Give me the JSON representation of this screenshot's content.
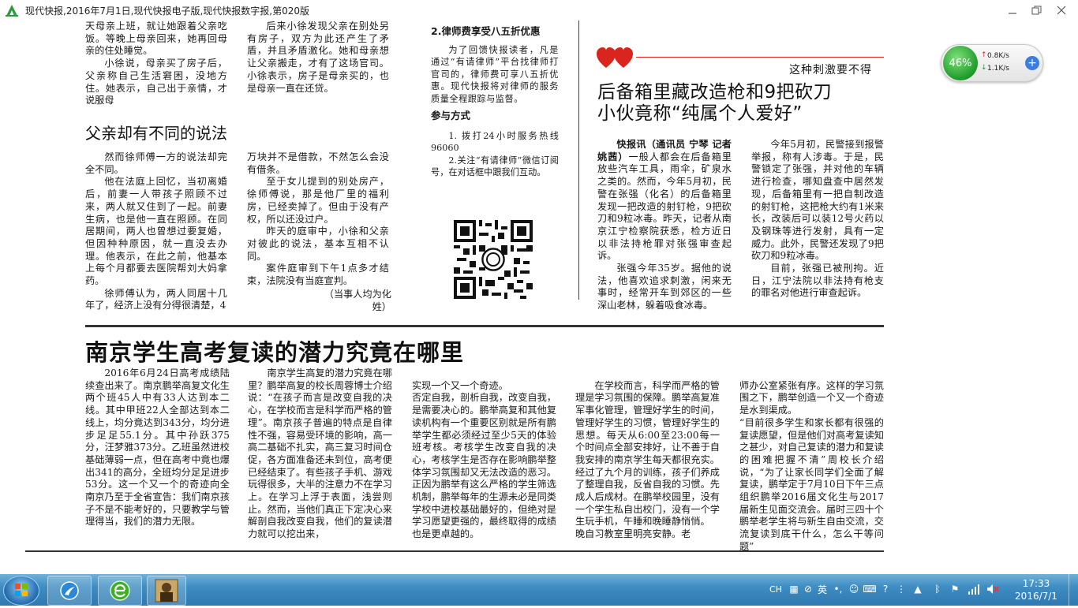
{
  "window": {
    "title": "现代快报,2016年7月1日,现代快报电子版,现代快报数字报,第020版"
  },
  "article_top_left": {
    "col1_lines": [
      "天母亲上班，就让她跟着父亲吃饭。等晚上母亲回来，她再回母亲的住处睡觉。",
      "小徐说，母亲买了房子后，父亲称自己生活窘困，没地方住。她表示，自己出于亲情，才说服母"
    ],
    "col2_lines": [
      "后来小徐发现父亲在别处另有房子，双方为此还产生了矛盾，并且矛盾激化。她和母亲想让父亲搬走，才有了这场官司。小徐表示，房子是母亲买的，也是母亲一直在还贷。"
    ],
    "subheading": "父亲却有不同的说法",
    "col1_body": [
      "然而徐师傅一方的说法却完全不同。",
      "他在法庭上回忆，当初离婚后，前妻一人带孩子照顾不过来，两人就又住到了一起。前妻生病，也是他一直在照顾。在同居期间，两人也曾想过要复婚，但因种种原因，就一直没去办理。他表示，在此之前，他基本上每个月都要去医院帮刘大妈拿药。",
      "徐师傅认为，两人同居十几年了，经济上没有分得很清楚，4"
    ],
    "col2_body": [
      "万块并不是借款，不然怎么会没有借条。",
      "至于女儿提到的别处房产，徐师傅说，那是他厂里的福利房，已经卖掉了。但由于没有产权，所以还没过户。",
      "昨天的庭审中，小徐和父亲对彼此的说法，基本互相不认同。",
      "案件庭审到下午1点多才结束，法院没有当庭宣判。"
    ],
    "note": "（当事人均为化姓）"
  },
  "sidebar": {
    "item2_title": "2.律师费享受八五折优惠",
    "item2_text": "为了回馈快报读者，凡是通过“有请律师”平台找律师打官司的，律师费可享八五折优惠。现代快报将对律师的服务质量全程跟踪与监督。",
    "how_title": "参与方式",
    "how_1": "1. 拨打24小时服务热线96060",
    "how_2": "2.关注“有请律师”微信订阅号，在对话框中跟我们互动。"
  },
  "article_gun": {
    "kicker": "这种刺激要不得",
    "headline_1": "后备箱里藏改造枪和9把砍刀",
    "headline_2": "小伙竟称“纯属个人爱好”",
    "byline": "快报讯（通讯员 宁琴 记者 姚茜）",
    "col1": [
      "一般人都会在后备箱里放些汽车工具，雨伞，矿泉水之类的。然而，今年5月初，民警在张强（化名）的后备箱里发现一把改造的射钉枪，9把砍刀和9粒冰毒。昨天，记者从南京江宁检察院获悉，检方近日以非法持枪罪对张强审查起诉。",
      "张强今年35岁。据他的说法，他喜欢追求刺激，闲来无事时，经常开车到郊区的一些深山老林，躲着吸食冰毒。"
    ],
    "col2": [
      "今年5月初，民警接到报警举报，称有人涉毒。于是，民警锁定了张强，并对他的车辆进行检查，哪知盘查中居然发现，后备箱里有一把自制改造的射钉枪，这把枪大约有1米来长，改装后可以装12号火药以及钢珠等进行发射，具有一定威力。此外，民警还发现了9把砍刀和9粒冰毒。",
      "目前，张强已被刑拘。近日，江宁法院以非法持有枪支的罪名对他进行审查起诉。"
    ]
  },
  "article_exam": {
    "headline": "南京学生高考复读的潜力究竟在哪里",
    "col1": "2016年6月24日高考成绩陆续查出来了。南京鹏举高复文化生两个班45人中有33人达到本二线。其中甲班22人全部达到本二线上，均分竟达到343分，均分进步足足55.1分。其中孙跃375分，汪梦雅373分。乙班虽然进校基础薄弱一点，但在高考中竟也爆出341的高分，全班均分足足进步53分。这一个又一个的奇迹向全南京乃至于全省宣告：我们南京孩子不是不能考好的，只要教学与管理得当，我们的潜力无限。",
    "col2": "南京学生高复的潜力究竟在哪里？鹏举高复的校长周蓉博士介绍说：“在孩子而言是改变自我的决心，在学校而言是科学而严格的管理”。南京孩子普遍的特点是自律性不强，容易受环境的影响，高一高二基础不扎实，高三复习时间仓促，各方面准备还未到位，高考便已经结束了。有些孩子手机、游戏玩得很多，大半的注意力不在学习上。在学习上浮于表面，浅尝则止。然而，当他们真正下定决心来解剖自我改变自我，他们的复读潜力就可以挖出来，",
    "col3": "实现一个又一个奇迹。\n否定自我，剖析自我，改变自我，是需要决心的。鹏举高复和其他复读机构有一个重要区别就是所有鹏举学生都必须经过至少5天的体验班考核。考核学生改变自我的决心，考核学生是否存在影响鹏举整体学习氛围却又无法改造的恶习。正因为鹏举有这么严格的学生筛选机制，鹏举每年的生源未必是同类学校中进校基础最好的，但绝对是学习愿望更强的，最终取得的成绩也是更卓越的。",
    "col4": "在学校而言，科学而严格的管理是学习氛围的保障。鹏举高复准军事化管理，管理好学生的时间，管理好学生的习惯，管理好学生的思想。每天从6:00至23:00每一个时间点全部安排好，让不善于自我安排的南京学生每天都很充实。经过了九个月的训练，孩子们养成了整理自我，反省自我的习惯。先成人后成材。在鹏举校园里，没有一个学生私自出校门，没有一个学生玩手机，午睡和晚睡静悄悄。\n晚自习教室里明亮安静。老",
    "col5": "师办公室紧张有序。这样的学习氛围之下，鹏举创造一个又一个奇迹是水到渠成。\n“目前很多学生和家长都有很强的复读愿望，但是他们对高考复读知之甚少，对自己复读的潜力和复读的困难把握不清”周校长介绍说，“为了让家长同学们全面了解复读，鹏举定于7月10日下午三点组织鹏举2016届文化生与2017届新生见面交流会。届时三四十个鹏举老学生将与新生自由交流，交流复读到底干什么，怎么干等问题”"
  },
  "net_widget": {
    "percent": "46%",
    "up": "0.8K/s",
    "down": "1.1K/s",
    "plus": "+"
  },
  "taskbar": {
    "lang": "CH",
    "ime": "英",
    "time": "17:33",
    "date": "2016/7/1"
  },
  "colors": {
    "titlebar_logo": "#2e9b3a",
    "taskbar": "#3f8dc2",
    "heart": "#d9251d",
    "widget_green": "#1f9b2a"
  }
}
